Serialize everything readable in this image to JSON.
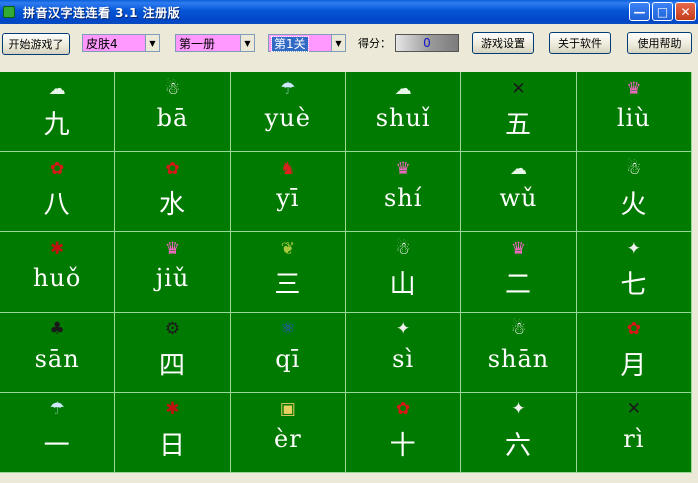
{
  "window": {
    "title": "拼音汉字连连看 3.1 注册版",
    "buttons": {
      "minimize": "—",
      "maximize": "□",
      "close": "✕"
    }
  },
  "toolbar": {
    "start_label": "开始游戏了",
    "skin_value": "皮肤4",
    "book_value": "第一册",
    "level_value": "第1关",
    "score_label": "得分：",
    "score_value": "0",
    "settings_label": "游戏设置",
    "about_label": "关于软件",
    "help_label": "使用帮助"
  },
  "colors": {
    "board": "#007a00",
    "grid_line": "#9ad89a",
    "combo_bg": "#ff99ff",
    "titlebar": "#0556d6"
  },
  "board": {
    "rows": [
      [
        {
          "icon": "cloud-icon",
          "glyph": "☁",
          "text": "九"
        },
        {
          "icon": "snowman-icon",
          "glyph": "☃",
          "text": "bā"
        },
        {
          "icon": "rain-icon",
          "glyph": "☂",
          "text": "yuè"
        },
        {
          "icon": "cloud-icon",
          "glyph": "☁",
          "text": "shuǐ"
        },
        {
          "icon": "bat-icon",
          "glyph": "✕",
          "text": "五"
        },
        {
          "icon": "ice-cream-icon",
          "glyph": "♛",
          "text": "liù"
        }
      ],
      [
        {
          "icon": "maple-leaf-icon",
          "glyph": "✿",
          "text": "八"
        },
        {
          "icon": "maple-leaf-icon",
          "glyph": "✿",
          "text": "水"
        },
        {
          "icon": "bird-icon",
          "glyph": "♞",
          "text": "yī"
        },
        {
          "icon": "ice-cream-icon",
          "glyph": "♛",
          "text": "shí"
        },
        {
          "icon": "cloud-icon",
          "glyph": "☁",
          "text": "wǔ"
        },
        {
          "icon": "snowman-icon",
          "glyph": "☃",
          "text": "火"
        }
      ],
      [
        {
          "icon": "ant-icon",
          "glyph": "✱",
          "text": "huǒ"
        },
        {
          "icon": "ice-cream-icon",
          "glyph": "♛",
          "text": "jiǔ"
        },
        {
          "icon": "leaf-icon",
          "glyph": "❦",
          "text": "三"
        },
        {
          "icon": "snowman-icon",
          "glyph": "☃",
          "text": "山"
        },
        {
          "icon": "ice-cream-icon",
          "glyph": "♛",
          "text": "二"
        },
        {
          "icon": "dog-icon",
          "glyph": "✦",
          "text": "七"
        }
      ],
      [
        {
          "icon": "frog-icon",
          "glyph": "♣",
          "text": "sān"
        },
        {
          "icon": "bicycle-icon",
          "glyph": "⚙",
          "text": "四"
        },
        {
          "icon": "atom-icon",
          "glyph": "⚛",
          "text": "qī"
        },
        {
          "icon": "dog-icon",
          "glyph": "✦",
          "text": "sì"
        },
        {
          "icon": "snowman-icon",
          "glyph": "☃",
          "text": "shān"
        },
        {
          "icon": "maple-leaf-icon",
          "glyph": "✿",
          "text": "月"
        }
      ],
      [
        {
          "icon": "rain-icon",
          "glyph": "☂",
          "text": "一"
        },
        {
          "icon": "ant-icon",
          "glyph": "✱",
          "text": "日"
        },
        {
          "icon": "book-icon",
          "glyph": "▣",
          "text": "èr"
        },
        {
          "icon": "maple-leaf-icon",
          "glyph": "✿",
          "text": "十"
        },
        {
          "icon": "dog-icon",
          "glyph": "✦",
          "text": "六"
        },
        {
          "icon": "bat-icon",
          "glyph": "✕",
          "text": "rì"
        }
      ]
    ]
  }
}
